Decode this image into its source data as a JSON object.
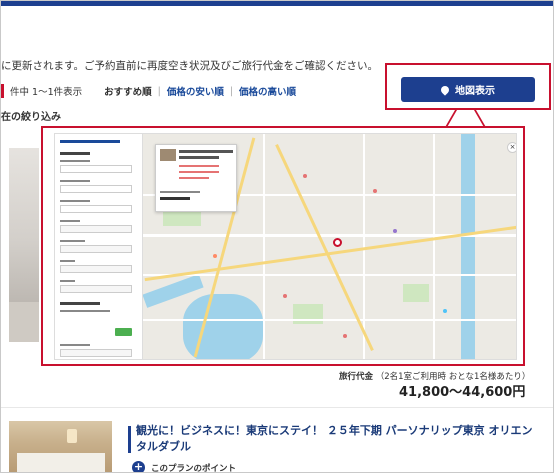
{
  "notice": "に更新されます。ご予約直前に再度空き状況及びご旅行代金をご確認ください。",
  "results": {
    "count": "件中 1～1件表示",
    "sort": {
      "recommended": "おすすめ順",
      "cheapest": "価格の安い順",
      "expensive": "価格の高い順"
    }
  },
  "filter_title": "在の絞り込み",
  "map_button": {
    "label": "地図表示",
    "icon": "pin-icon"
  },
  "map_modal": {
    "close_icon": "close-icon",
    "close_glyph": "×"
  },
  "price": {
    "label": "旅行代金",
    "note": "（2名1室ご利用時 おとな1名様あたり）",
    "value": "41,800～44,600円"
  },
  "plan": {
    "title": "観光に！ビジネスに！東京にステイ！ ２５年下期 パーソナリップ東京 オリエンタルダブル",
    "point_label": "このプランのポイント",
    "point_glyph": "+"
  },
  "colors": {
    "brand_blue": "#1d3f8f",
    "highlight_red": "#c8102e"
  }
}
